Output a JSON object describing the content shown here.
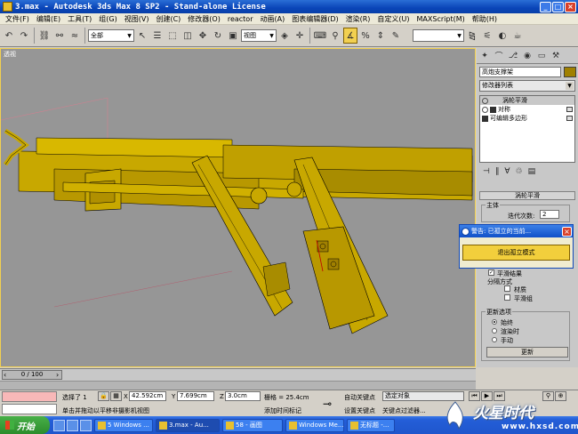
{
  "window": {
    "title": "3.max - Autodesk 3ds Max 8 SP2 - Stand-alone License",
    "buttons": [
      "_",
      "□",
      "×"
    ]
  },
  "menu": [
    "文件(F)",
    "编辑(E)",
    "工具(T)",
    "组(G)",
    "视图(V)",
    "创建(C)",
    "修改器(O)",
    "reactor",
    "动画(A)",
    "图表编辑器(D)",
    "渲染(R)",
    "自定义(U)",
    "MAXScript(M)",
    "帮助(H)"
  ],
  "toolbar": {
    "selection_filter": "全部",
    "reference_coord": "视图"
  },
  "viewport": {
    "label": "透视",
    "model_color": "#c8a800",
    "background": "#969696"
  },
  "command_panel": {
    "object_name": "高炮支撑架",
    "object_color": "#a08000",
    "modifier_list": "修改器列表",
    "stack": [
      {
        "label": "涡轮平滑",
        "selected": true
      },
      {
        "label": "对称",
        "selected": false
      },
      {
        "label": "可编辑多边形",
        "selected": false
      }
    ],
    "rollout_title": "涡轮平滑",
    "main_group": "主体",
    "iterations_label": "迭代次数:",
    "iterations_value": "2",
    "smooth_result": "平滑结果",
    "separate_label": "分隔方式",
    "separate_options": [
      "材质",
      "平滑组"
    ],
    "update_group": "更新选项",
    "update_options": [
      {
        "label": "始终",
        "selected": true
      },
      {
        "label": "渲染时",
        "selected": false
      },
      {
        "label": "手动",
        "selected": false
      }
    ],
    "update_button": "更新"
  },
  "warning_dialog": {
    "title": "警告: 已孤立的当前...",
    "button": "退出孤立模式"
  },
  "time_slider": {
    "position": "0 / 100"
  },
  "status": {
    "selection": "选择了 1",
    "prompt": "单击并拖动以平移非摄影机视图",
    "x_label": "X",
    "x_value": "42.592cm",
    "y_label": "Y",
    "y_value": "7.699cm",
    "z_label": "Z",
    "z_value": "3.0cm",
    "grid": "栅格 = 25.4cm",
    "add_time_tag": "添加时间标记",
    "auto_key": "自动关键点",
    "set_key": "设置关键点",
    "key_filter_select": "选定对象",
    "key_filters": "关键点过滤器..."
  },
  "taskbar": {
    "start": "开始",
    "tasks": [
      "5 Windows ...",
      "3.max - Au...",
      "58 - 画图",
      "Windows Me...",
      "无标题 -..."
    ]
  },
  "watermark": {
    "text": "火星时代",
    "url": "www.hxsd.com"
  }
}
